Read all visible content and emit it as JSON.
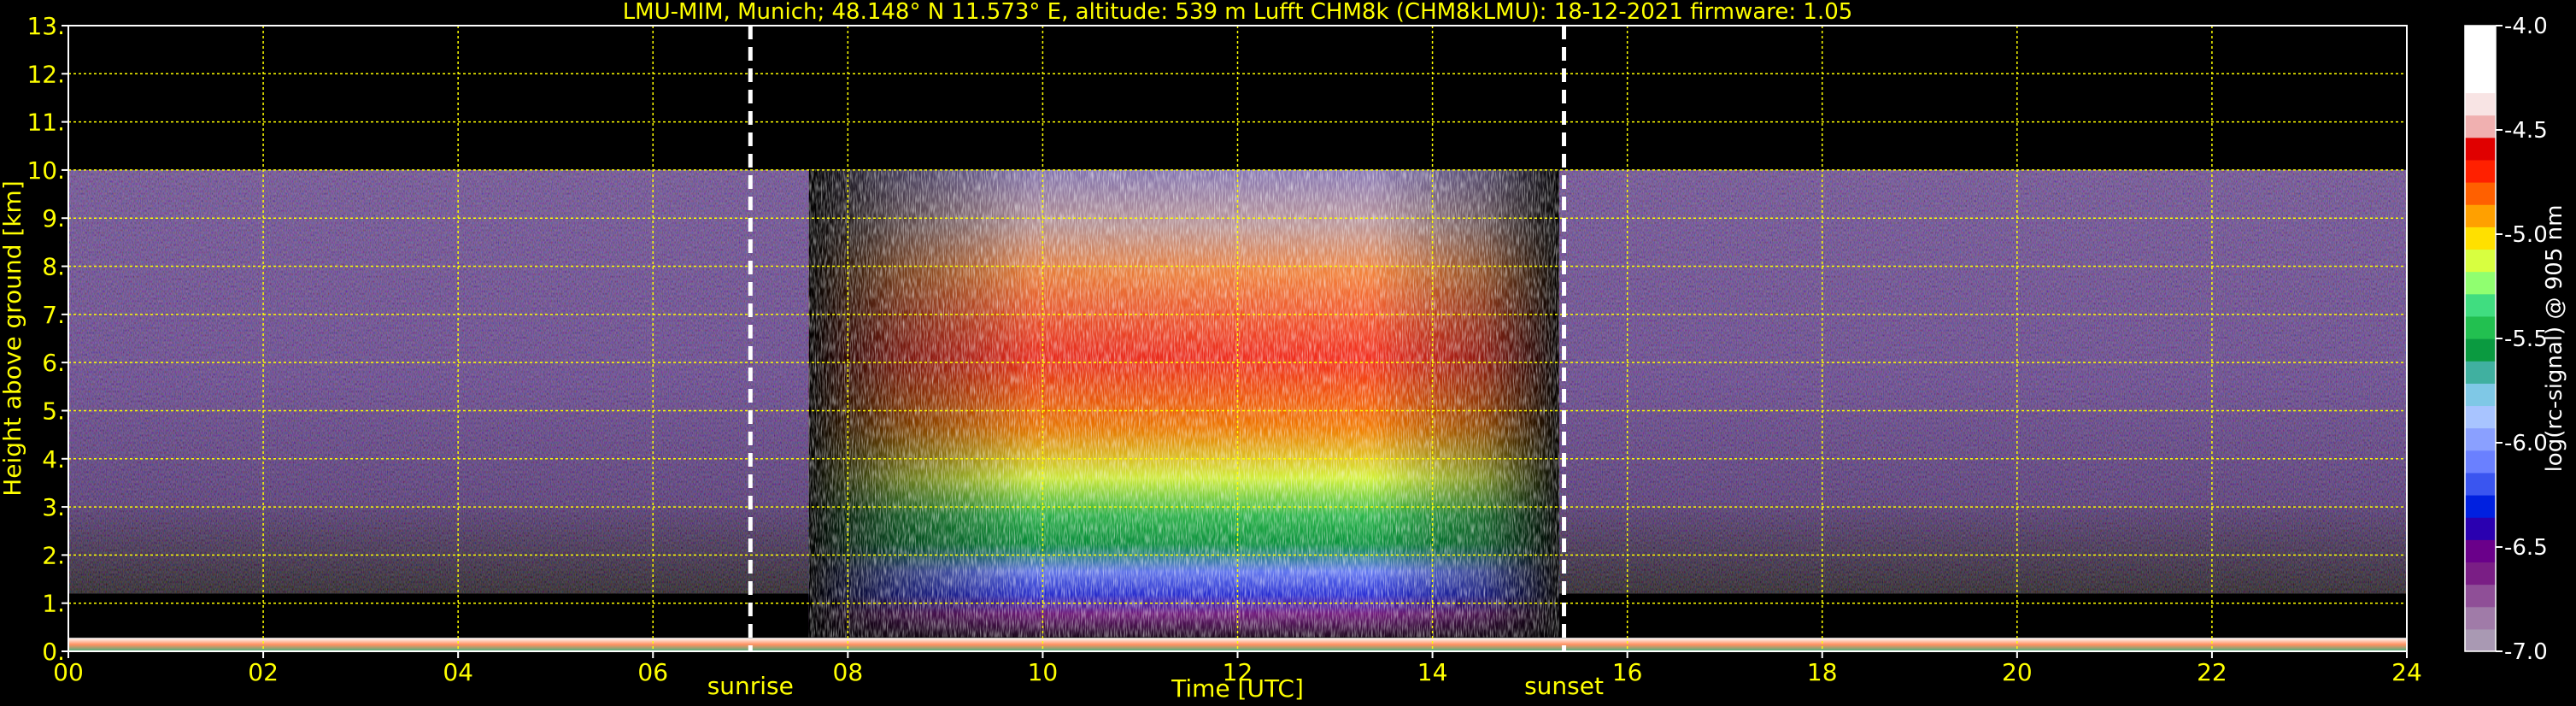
{
  "header": {
    "title": "LMU-MIM, Munich; 48.148° N 11.573° E, altitude: 539 m    Lufft CHM8k (CHM8kLMU): 18-12-2021    firmware: 1.05"
  },
  "chart_data": {
    "type": "heatmap",
    "title": "LMU-MIM, Munich; 48.148° N 11.573° E, altitude: 539 m    Lufft CHM8k (CHM8kLMU): 18-12-2021    firmware: 1.05",
    "xlabel": "Time [UTC]",
    "ylabel": "Height above ground [km]",
    "xlim": [
      0,
      24
    ],
    "ylim": [
      0,
      13
    ],
    "x_tick_labels": [
      "00",
      "02",
      "04",
      "06",
      "08",
      "10",
      "12",
      "14",
      "16",
      "18",
      "20",
      "22",
      "24"
    ],
    "y_tick_labels": [
      "0.",
      "1.",
      "2.",
      "3.",
      "4.",
      "5.",
      "6.",
      "7.",
      "8.",
      "9.",
      "10.",
      "11.",
      "12.",
      "13."
    ],
    "grid": true,
    "data_top_km": 10,
    "events": [
      {
        "label": "sunrise",
        "time": 7.0
      },
      {
        "label": "sunset",
        "time": 15.35
      }
    ],
    "colorbar": {
      "label": "log(rc-signal) @ 905 nm",
      "range": [
        -7.0,
        -4.0
      ],
      "tick_labels": [
        "-4.0",
        "-4.5",
        "-5.0",
        "-5.5",
        "-6.0",
        "-6.5",
        "-7.0"
      ],
      "colors": [
        "#a999b3",
        "#a07ba8",
        "#8f4f97",
        "#7a1e85",
        "#6a008a",
        "#2a00b0",
        "#0020e0",
        "#3a55f0",
        "#6a80ff",
        "#8aa0ff",
        "#a8c4ff",
        "#7fc8e6",
        "#40b0a0",
        "#0a9a40",
        "#22c050",
        "#40dd80",
        "#90ff70",
        "#d8ff40",
        "#ffe000",
        "#ffa000",
        "#ff6000",
        "#ff2000",
        "#e00000",
        "#f0b0b0",
        "#f8e4e4",
        "#ffffff",
        "#ffffff",
        "#ffffff"
      ]
    }
  }
}
